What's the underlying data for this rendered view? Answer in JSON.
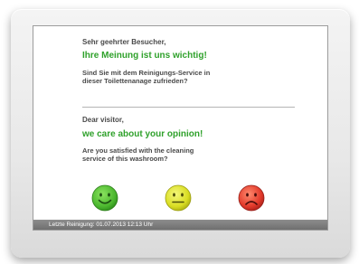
{
  "german": {
    "greeting": "Sehr geehrter Besucher,",
    "headline": "Ihre Meinung ist uns wichtig!",
    "question_line1": "Sind Sie mit dem Reinigungs-Service in",
    "question_line2": "dieser Toilettenanage zufrieden?"
  },
  "english": {
    "greeting": "Dear visitor,",
    "headline": "we care about your opinion!",
    "question_line1": "Are you satisfied with the cleaning",
    "question_line2": "service of this washroom?"
  },
  "ratings": [
    {
      "name": "happy",
      "color": "#4cb82f",
      "icon": "happy-face-icon"
    },
    {
      "name": "neutral",
      "color": "#d9dd22",
      "icon": "neutral-face-icon"
    },
    {
      "name": "sad",
      "color": "#e2392a",
      "icon": "sad-face-icon"
    }
  ],
  "footer": {
    "last_cleaning": "Letzte Reinigung: 01.07.2013 12:13 Uhr"
  }
}
